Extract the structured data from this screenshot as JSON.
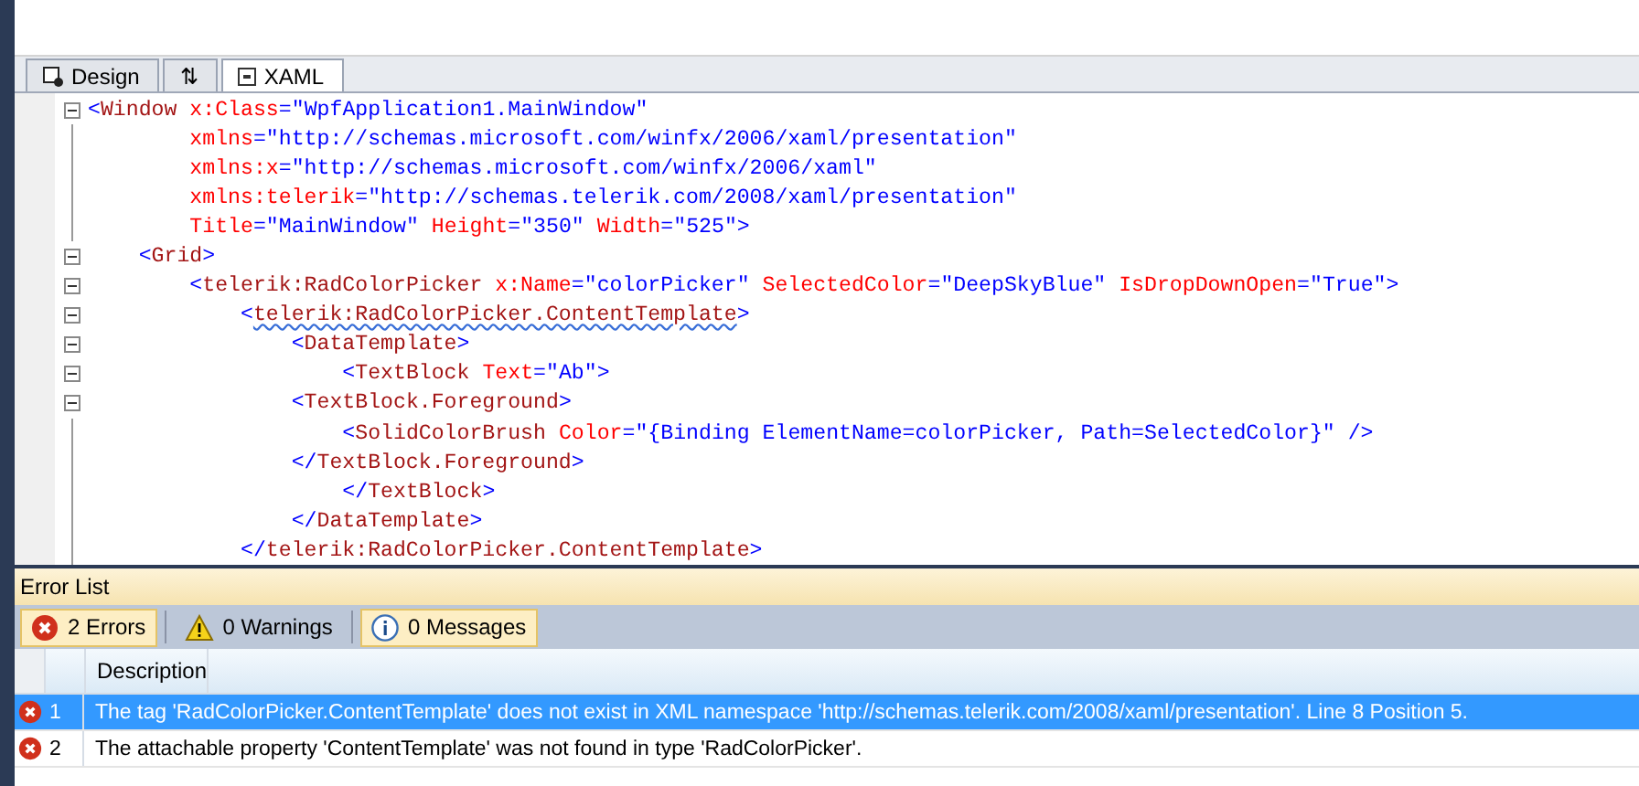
{
  "tabs": [
    {
      "label": "Design",
      "kind": "design",
      "selected": false
    },
    {
      "label": "⇅",
      "kind": "swap",
      "selected": false
    },
    {
      "label": "XAML",
      "kind": "xaml",
      "selected": true
    }
  ],
  "code": [
    {
      "fold": true,
      "tokens": [
        {
          "text": "<",
          "kind": "punct"
        },
        {
          "text": "Window",
          "kind": "tag"
        },
        {
          "text": " x:Class",
          "kind": "attr"
        },
        {
          "text": "=",
          "kind": "punct"
        },
        {
          "text": "\"WpfApplication1.MainWindow\"",
          "kind": "value"
        }
      ]
    },
    {
      "fold": false,
      "tokens": [
        {
          "text": "        xmlns",
          "kind": "attr"
        },
        {
          "text": "=",
          "kind": "punct"
        },
        {
          "text": "\"http://schemas.microsoft.com/winfx/2006/xaml/presentation\"",
          "kind": "value"
        }
      ]
    },
    {
      "fold": false,
      "tokens": [
        {
          "text": "        xmlns:x",
          "kind": "attr"
        },
        {
          "text": "=",
          "kind": "punct"
        },
        {
          "text": "\"http://schemas.microsoft.com/winfx/2006/xaml\"",
          "kind": "value"
        }
      ]
    },
    {
      "fold": false,
      "tokens": [
        {
          "text": "        xmlns:telerik",
          "kind": "attr"
        },
        {
          "text": "=",
          "kind": "punct"
        },
        {
          "text": "\"http://schemas.telerik.com/2008/xaml/presentation\"",
          "kind": "value"
        }
      ]
    },
    {
      "fold": false,
      "tokens": [
        {
          "text": "        Title",
          "kind": "attr"
        },
        {
          "text": "=",
          "kind": "punct"
        },
        {
          "text": "\"MainWindow\"",
          "kind": "value"
        },
        {
          "text": " Height",
          "kind": "attr"
        },
        {
          "text": "=",
          "kind": "punct"
        },
        {
          "text": "\"350\"",
          "kind": "value"
        },
        {
          "text": " Width",
          "kind": "attr"
        },
        {
          "text": "=",
          "kind": "punct"
        },
        {
          "text": "\"525\"",
          "kind": "value"
        },
        {
          "text": ">",
          "kind": "punct"
        }
      ]
    },
    {
      "fold": true,
      "tokens": [
        {
          "text": "    <",
          "kind": "punct"
        },
        {
          "text": "Grid",
          "kind": "tag"
        },
        {
          "text": ">",
          "kind": "punct"
        }
      ]
    },
    {
      "fold": true,
      "tokens": [
        {
          "text": "        <",
          "kind": "punct"
        },
        {
          "text": "telerik:RadColorPicker",
          "kind": "tag"
        },
        {
          "text": " x:Name",
          "kind": "attr"
        },
        {
          "text": "=",
          "kind": "punct"
        },
        {
          "text": "\"colorPicker\"",
          "kind": "value"
        },
        {
          "text": " SelectedColor",
          "kind": "attr"
        },
        {
          "text": "=",
          "kind": "punct"
        },
        {
          "text": "\"DeepSkyBlue\"",
          "kind": "value"
        },
        {
          "text": " IsDropDownOpen",
          "kind": "attr"
        },
        {
          "text": "=",
          "kind": "punct"
        },
        {
          "text": "\"True\"",
          "kind": "value"
        },
        {
          "text": ">",
          "kind": "punct"
        }
      ]
    },
    {
      "fold": true,
      "tokens": [
        {
          "text": "            <",
          "kind": "punct"
        },
        {
          "text": "telerik:RadColorPicker.ContentTemplate",
          "kind": "tag",
          "error": true
        },
        {
          "text": ">",
          "kind": "punct"
        }
      ]
    },
    {
      "fold": true,
      "tokens": [
        {
          "text": "                <",
          "kind": "punct"
        },
        {
          "text": "DataTemplate",
          "kind": "tag"
        },
        {
          "text": ">",
          "kind": "punct"
        }
      ]
    },
    {
      "fold": true,
      "tokens": [
        {
          "text": "                    <",
          "kind": "punct"
        },
        {
          "text": "TextBlock",
          "kind": "tag"
        },
        {
          "text": " Text",
          "kind": "attr"
        },
        {
          "text": "=",
          "kind": "punct"
        },
        {
          "text": "\"Ab\"",
          "kind": "value"
        },
        {
          "text": ">",
          "kind": "punct"
        }
      ]
    },
    {
      "fold": true,
      "tokens": [
        {
          "text": "                <",
          "kind": "punct"
        },
        {
          "text": "TextBlock.Foreground",
          "kind": "tag"
        },
        {
          "text": ">",
          "kind": "punct"
        }
      ]
    },
    {
      "fold": false,
      "tokens": [
        {
          "text": "                    <",
          "kind": "punct"
        },
        {
          "text": "SolidColorBrush",
          "kind": "tag"
        },
        {
          "text": " Color",
          "kind": "attr"
        },
        {
          "text": "=",
          "kind": "punct"
        },
        {
          "text": "\"{Binding ElementName=colorPicker, Path=SelectedColor}\"",
          "kind": "value"
        },
        {
          "text": " />",
          "kind": "punct"
        }
      ]
    },
    {
      "fold": false,
      "tokens": [
        {
          "text": "                </",
          "kind": "punct"
        },
        {
          "text": "TextBlock.Foreground",
          "kind": "tag"
        },
        {
          "text": ">",
          "kind": "punct"
        }
      ]
    },
    {
      "fold": false,
      "tokens": [
        {
          "text": "                    </",
          "kind": "punct"
        },
        {
          "text": "TextBlock",
          "kind": "tag"
        },
        {
          "text": ">",
          "kind": "punct"
        }
      ]
    },
    {
      "fold": false,
      "tokens": [
        {
          "text": "                </",
          "kind": "punct"
        },
        {
          "text": "DataTemplate",
          "kind": "tag"
        },
        {
          "text": ">",
          "kind": "punct"
        }
      ]
    },
    {
      "fold": false,
      "tokens": [
        {
          "text": "            </",
          "kind": "punct"
        },
        {
          "text": "telerik:RadColorPicker.ContentTemplate",
          "kind": "tag"
        },
        {
          "text": ">",
          "kind": "punct"
        }
      ]
    }
  ],
  "error_list": {
    "title": "Error List",
    "filters": [
      {
        "label": "2 Errors",
        "kind": "error",
        "selected": true
      },
      {
        "label": "0 Warnings",
        "kind": "warning",
        "selected": false
      },
      {
        "label": "0 Messages",
        "kind": "info",
        "selected": true
      }
    ],
    "columns": [
      "Description"
    ],
    "rows": [
      {
        "number": "1",
        "description": "The tag 'RadColorPicker.ContentTemplate' does not exist in XML namespace 'http://schemas.telerik.com/2008/xaml/presentation'. Line 8 Position 5.",
        "selected": true
      },
      {
        "number": "2",
        "description": "The attachable property 'ContentTemplate' was not found in type 'RadColorPicker'.",
        "selected": false
      }
    ]
  }
}
